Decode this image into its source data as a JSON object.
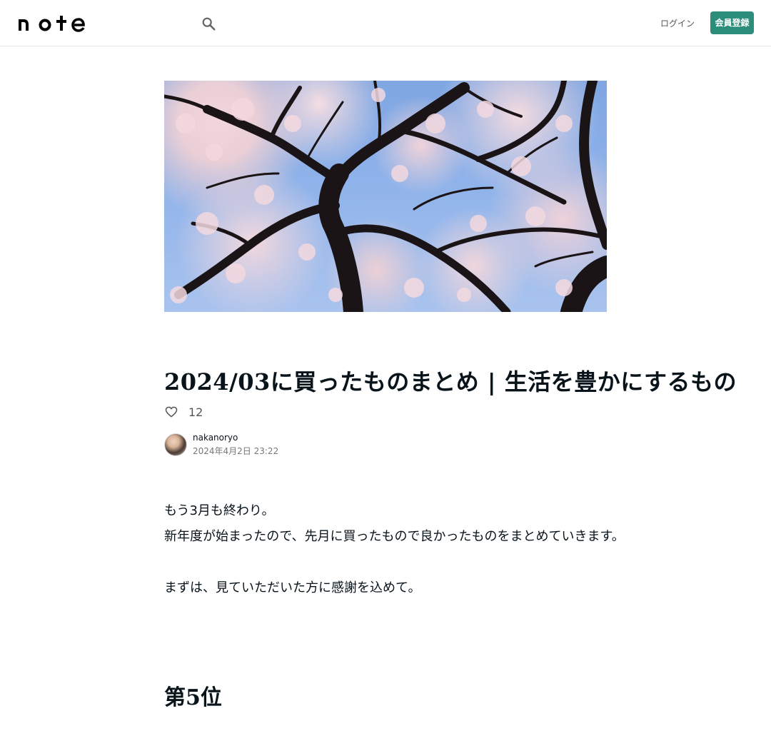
{
  "header": {
    "logo_text": "note",
    "login_label": "ログイン",
    "signup_label": "会員登録",
    "colors": {
      "accent": "#2b8e7a"
    },
    "icons": {
      "search": "search-icon"
    }
  },
  "hero": {
    "image_desc": "cherry-blossom-photo"
  },
  "article": {
    "title": "2024/03に買ったものまとめ | 生活を豊かにするもの",
    "like_icon": "heart-icon",
    "like_count": "12",
    "author_name": "nakanoryo",
    "post_date": "2024年4月2日 23:22",
    "paragraphs": [
      "もう3月も終わり。",
      "新年度が始まったので、先月に買ったもので良かったものをまとめていきます。",
      "まずは、見ていただいた方に感謝を込めて。"
    ],
    "section_heading": "第5位"
  }
}
